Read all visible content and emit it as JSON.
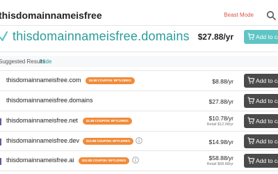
{
  "header": {
    "search_query": "thisdomainnameisfree",
    "beast_mode_label": "Beast Mode"
  },
  "featured": {
    "domain": "thisdomainnameisfree.domains",
    "price": "$27.88/yr",
    "cart_label": "Add to cart"
  },
  "suggested": {
    "title": "Suggested Results",
    "hide_label": "Hide",
    "rows": [
      {
        "domain": "thisdomainnameisfree.com",
        "coupon": "$4.98 COUPON: BFTLDREG",
        "price": "$8.88/yr",
        "retail": "",
        "cart_label": "Add to cart"
      },
      {
        "domain": "thisdomainnameisfree.domains",
        "coupon": "",
        "price": "$27.88/yr",
        "retail": "",
        "cart_label": "Add to cart"
      },
      {
        "domain": "thisdomainnameisfree.net",
        "coupon": "$1.88 COUPON: BFTLDREG",
        "price": "$10.78/yr",
        "retail": "Retail $12.98/yr",
        "cart_label": "Add to cart"
      },
      {
        "domain": "thisdomainnameisfree.dev",
        "coupon": "$10.88 COUPON: BFTLDREG",
        "price": "$14.98/yr",
        "retail": "",
        "cart_label": "Add to cart"
      },
      {
        "domain": "thisdomainnameisfree.ai",
        "coupon": "$10.88 COUPON: BFTLDREG",
        "price": "$58.88/yr",
        "retail": "Retail $68.88/yr",
        "cart_label": "Add to cart"
      }
    ]
  },
  "colors": {
    "accent_teal": "#5fc5c4",
    "domain_teal": "#2a9d9a",
    "coupon_orange": "#f08c3c",
    "beast_mode_red": "#d9534f",
    "cart_dark": "#4a4a4a"
  },
  "icons": {
    "search": "search-icon",
    "check": "check-icon",
    "cart": "cart-icon",
    "info": "info-icon"
  }
}
